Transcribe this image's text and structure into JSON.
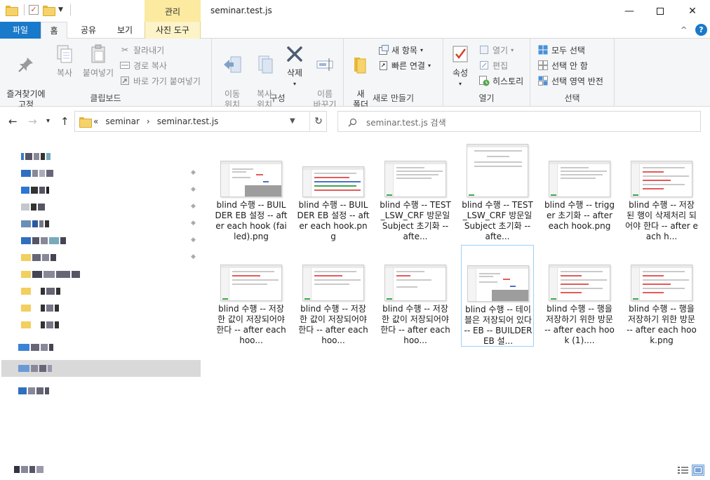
{
  "window": {
    "title": "seminar.test.js",
    "context_tab_header": "관리",
    "controls": {
      "minimize": "—",
      "close": "✕"
    }
  },
  "ribbon_tabs": {
    "file": "파일",
    "home": "홈",
    "share": "공유",
    "view": "보기",
    "picture_tools": "사진 도구",
    "collapse": "^",
    "help": "?"
  },
  "ribbon": {
    "clipboard": {
      "label": "클립보드",
      "pin": "즐겨찾기에\n고정",
      "copy": "복사",
      "paste": "붙여넣기",
      "cut": "잘라내기",
      "copy_path": "경로 복사",
      "paste_shortcut": "바로 가기 붙여넣기"
    },
    "organize": {
      "label": "구성",
      "move_to": "이동\n위치",
      "copy_to": "복사\n위치",
      "delete": "삭제",
      "rename": "이름\n바꾸기"
    },
    "new": {
      "label": "새로 만들기",
      "new_folder": "새\n폴더",
      "new_item": "새 항목",
      "easy_access": "빠른 연결"
    },
    "open": {
      "label": "열기",
      "properties": "속성",
      "open": "열기",
      "edit": "편집",
      "history": "히스토리"
    },
    "select": {
      "label": "선택",
      "select_all": "모두 선택",
      "select_none": "선택 안 함",
      "invert": "선택 영역 반전"
    }
  },
  "address": {
    "crumbs": [
      "«",
      "seminar",
      "›",
      "seminar.test.js"
    ],
    "refresh": "↻"
  },
  "search": {
    "placeholder": "seminar.test.js 검색"
  },
  "files": [
    {
      "name": "blind 수행 -- BUILDER EB 설정 -- after each hook (failed).png",
      "variant": "a"
    },
    {
      "name": "blind 수행 -- BUILDER EB 설정 -- after each hook.png",
      "variant": "b"
    },
    {
      "name": "blind 수행 -- TEST_LSW_CRF 방문일 Subject 초기화 -- afte...",
      "variant": "c"
    },
    {
      "name": "blind 수행 -- TEST_LSW_CRF 방문일 Subject 초기화 -- afte...",
      "variant": "d"
    },
    {
      "name": "blind 수행 -- trigger 초기화 -- after each hook.png",
      "variant": "c"
    },
    {
      "name": "blind 수행 -- 저장된 행이 삭제처리 되어야 한다 -- after each h...",
      "variant": "e"
    },
    {
      "name": "blind 수행 -- 저장한 값이 저장되어야 한다 -- after each hoo...",
      "variant": "f"
    },
    {
      "name": "blind 수행 -- 저장한 값이 저장되어야 한다 -- after each hoo...",
      "variant": "f"
    },
    {
      "name": "blind 수행 -- 저장한 값이 저장되어야 한다 -- after each hoo...",
      "variant": "g"
    },
    {
      "name": "blind 수행 -- 테이블은 저장되어 있다 -- EB -- BUILDER EB 설...",
      "variant": "a"
    },
    {
      "name": "blind 수행 -- 행을 저장하기 위한 방문 -- after each hook (1)....",
      "variant": "e"
    },
    {
      "name": "blind 수행 -- 행을 저장하기 위한 방문 -- after each hook.png",
      "variant": "e"
    }
  ],
  "colors": {
    "file_tab": "#1979ca",
    "context_tab": "#fbeaa0",
    "selection_border": "#99d1ff",
    "nav_selected": "#d9d9d9"
  }
}
